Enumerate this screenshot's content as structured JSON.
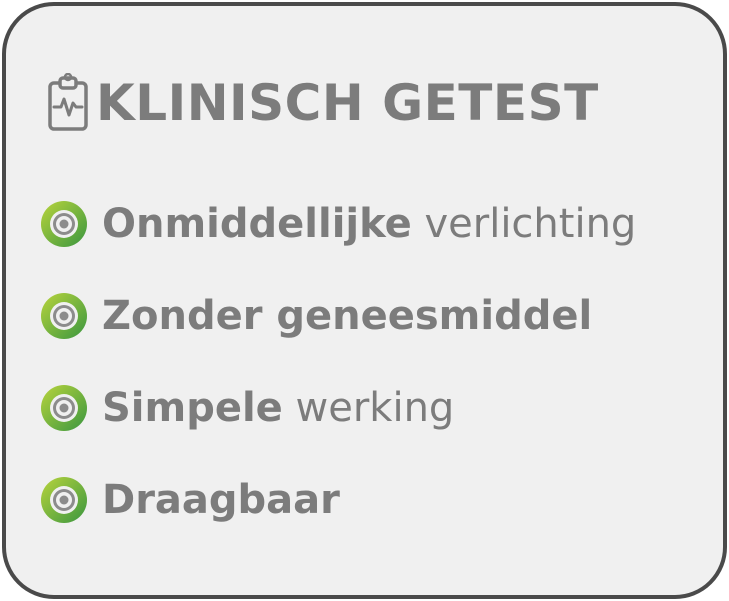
{
  "header": {
    "title": "KLINISCH GETEST",
    "icon": "clipboard-heartbeat-icon"
  },
  "features": [
    {
      "bold": "Onmiddellijke",
      "regular": " verlichting",
      "icon": "target-icon"
    },
    {
      "bold": "Zonder geneesmiddel",
      "regular": "",
      "icon": "target-icon"
    },
    {
      "bold": "Simpele",
      "regular": " werking",
      "icon": "target-icon"
    },
    {
      "bold": "Draagbaar",
      "regular": "",
      "icon": "target-icon"
    }
  ],
  "colors": {
    "text": "#7c7c7c",
    "card_background": "#f0f0f0",
    "border": "#4a4a4a",
    "accent_green_light": "#a6c93c",
    "accent_green_dark": "#3f9a3c"
  }
}
